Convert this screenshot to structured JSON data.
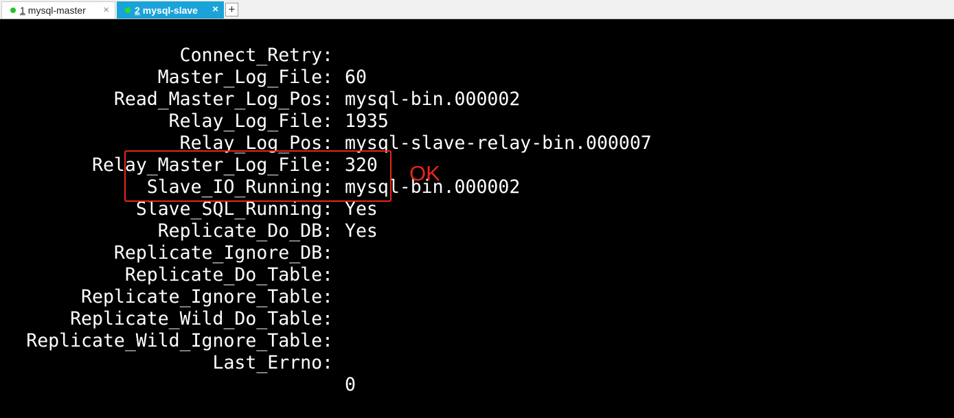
{
  "tabs": [
    {
      "number": "1",
      "title": "mysql-master",
      "close": "×"
    },
    {
      "number": "2",
      "title": "mysql-slave",
      "close": "×"
    }
  ],
  "new_tab_label": "+",
  "terminal": {
    "lines": [
      {
        "label": "Connect_Retry:",
        "value": "60"
      },
      {
        "label": "Master_Log_File:",
        "value": "mysql-bin.000002"
      },
      {
        "label": "Read_Master_Log_Pos:",
        "value": "1935"
      },
      {
        "label": "Relay_Log_File:",
        "value": "mysql-slave-relay-bin.000007"
      },
      {
        "label": "Relay_Log_Pos:",
        "value": "320"
      },
      {
        "label": "Relay_Master_Log_File:",
        "value": "mysql-bin.000002"
      },
      {
        "label": "Slave_IO_Running:",
        "value": "Yes"
      },
      {
        "label": "Slave_SQL_Running:",
        "value": "Yes"
      },
      {
        "label": "Replicate_Do_DB:",
        "value": ""
      },
      {
        "label": "Replicate_Ignore_DB:",
        "value": ""
      },
      {
        "label": "Replicate_Do_Table:",
        "value": ""
      },
      {
        "label": "Replicate_Ignore_Table:",
        "value": ""
      },
      {
        "label": "Replicate_Wild_Do_Table:",
        "value": ""
      },
      {
        "label": "Replicate_Wild_Ignore_Table:",
        "value": ""
      },
      {
        "label": "Last_Errno:",
        "value": "0"
      }
    ]
  },
  "annotation": {
    "text": "OK",
    "color": "#e8271b"
  },
  "colors": {
    "active_tab": "#1aa3d9",
    "status_dot": "#1ec81e",
    "terminal_bg": "#000000",
    "terminal_fg": "#ffffff"
  }
}
